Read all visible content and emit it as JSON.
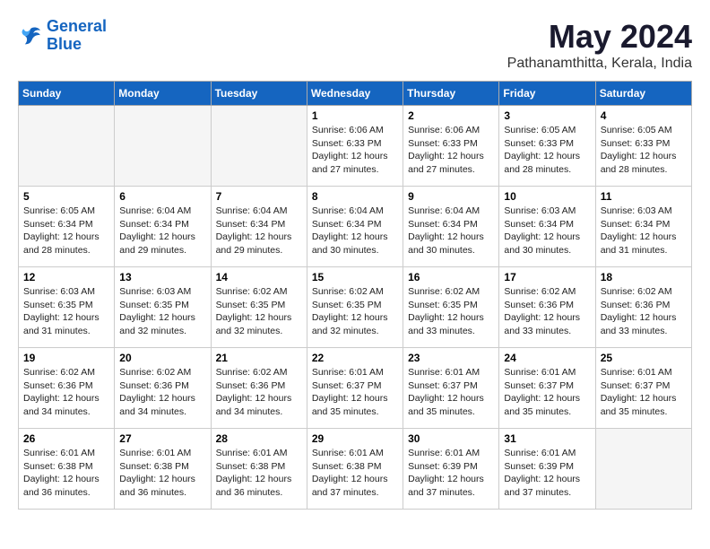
{
  "logo": {
    "line1": "General",
    "line2": "Blue"
  },
  "title": "May 2024",
  "location": "Pathanamthitta, Kerala, India",
  "weekdays": [
    "Sunday",
    "Monday",
    "Tuesday",
    "Wednesday",
    "Thursday",
    "Friday",
    "Saturday"
  ],
  "weeks": [
    [
      {
        "day": null,
        "sunrise": null,
        "sunset": null,
        "daylight": null
      },
      {
        "day": null,
        "sunrise": null,
        "sunset": null,
        "daylight": null
      },
      {
        "day": null,
        "sunrise": null,
        "sunset": null,
        "daylight": null
      },
      {
        "day": 1,
        "sunrise": "6:06 AM",
        "sunset": "6:33 PM",
        "daylight": "12 hours and 27 minutes."
      },
      {
        "day": 2,
        "sunrise": "6:06 AM",
        "sunset": "6:33 PM",
        "daylight": "12 hours and 27 minutes."
      },
      {
        "day": 3,
        "sunrise": "6:05 AM",
        "sunset": "6:33 PM",
        "daylight": "12 hours and 28 minutes."
      },
      {
        "day": 4,
        "sunrise": "6:05 AM",
        "sunset": "6:33 PM",
        "daylight": "12 hours and 28 minutes."
      }
    ],
    [
      {
        "day": 5,
        "sunrise": "6:05 AM",
        "sunset": "6:34 PM",
        "daylight": "12 hours and 28 minutes."
      },
      {
        "day": 6,
        "sunrise": "6:04 AM",
        "sunset": "6:34 PM",
        "daylight": "12 hours and 29 minutes."
      },
      {
        "day": 7,
        "sunrise": "6:04 AM",
        "sunset": "6:34 PM",
        "daylight": "12 hours and 29 minutes."
      },
      {
        "day": 8,
        "sunrise": "6:04 AM",
        "sunset": "6:34 PM",
        "daylight": "12 hours and 30 minutes."
      },
      {
        "day": 9,
        "sunrise": "6:04 AM",
        "sunset": "6:34 PM",
        "daylight": "12 hours and 30 minutes."
      },
      {
        "day": 10,
        "sunrise": "6:03 AM",
        "sunset": "6:34 PM",
        "daylight": "12 hours and 30 minutes."
      },
      {
        "day": 11,
        "sunrise": "6:03 AM",
        "sunset": "6:34 PM",
        "daylight": "12 hours and 31 minutes."
      }
    ],
    [
      {
        "day": 12,
        "sunrise": "6:03 AM",
        "sunset": "6:35 PM",
        "daylight": "12 hours and 31 minutes."
      },
      {
        "day": 13,
        "sunrise": "6:03 AM",
        "sunset": "6:35 PM",
        "daylight": "12 hours and 32 minutes."
      },
      {
        "day": 14,
        "sunrise": "6:02 AM",
        "sunset": "6:35 PM",
        "daylight": "12 hours and 32 minutes."
      },
      {
        "day": 15,
        "sunrise": "6:02 AM",
        "sunset": "6:35 PM",
        "daylight": "12 hours and 32 minutes."
      },
      {
        "day": 16,
        "sunrise": "6:02 AM",
        "sunset": "6:35 PM",
        "daylight": "12 hours and 33 minutes."
      },
      {
        "day": 17,
        "sunrise": "6:02 AM",
        "sunset": "6:36 PM",
        "daylight": "12 hours and 33 minutes."
      },
      {
        "day": 18,
        "sunrise": "6:02 AM",
        "sunset": "6:36 PM",
        "daylight": "12 hours and 33 minutes."
      }
    ],
    [
      {
        "day": 19,
        "sunrise": "6:02 AM",
        "sunset": "6:36 PM",
        "daylight": "12 hours and 34 minutes."
      },
      {
        "day": 20,
        "sunrise": "6:02 AM",
        "sunset": "6:36 PM",
        "daylight": "12 hours and 34 minutes."
      },
      {
        "day": 21,
        "sunrise": "6:02 AM",
        "sunset": "6:36 PM",
        "daylight": "12 hours and 34 minutes."
      },
      {
        "day": 22,
        "sunrise": "6:01 AM",
        "sunset": "6:37 PM",
        "daylight": "12 hours and 35 minutes."
      },
      {
        "day": 23,
        "sunrise": "6:01 AM",
        "sunset": "6:37 PM",
        "daylight": "12 hours and 35 minutes."
      },
      {
        "day": 24,
        "sunrise": "6:01 AM",
        "sunset": "6:37 PM",
        "daylight": "12 hours and 35 minutes."
      },
      {
        "day": 25,
        "sunrise": "6:01 AM",
        "sunset": "6:37 PM",
        "daylight": "12 hours and 35 minutes."
      }
    ],
    [
      {
        "day": 26,
        "sunrise": "6:01 AM",
        "sunset": "6:38 PM",
        "daylight": "12 hours and 36 minutes."
      },
      {
        "day": 27,
        "sunrise": "6:01 AM",
        "sunset": "6:38 PM",
        "daylight": "12 hours and 36 minutes."
      },
      {
        "day": 28,
        "sunrise": "6:01 AM",
        "sunset": "6:38 PM",
        "daylight": "12 hours and 36 minutes."
      },
      {
        "day": 29,
        "sunrise": "6:01 AM",
        "sunset": "6:38 PM",
        "daylight": "12 hours and 37 minutes."
      },
      {
        "day": 30,
        "sunrise": "6:01 AM",
        "sunset": "6:39 PM",
        "daylight": "12 hours and 37 minutes."
      },
      {
        "day": 31,
        "sunrise": "6:01 AM",
        "sunset": "6:39 PM",
        "daylight": "12 hours and 37 minutes."
      },
      {
        "day": null,
        "sunrise": null,
        "sunset": null,
        "daylight": null
      }
    ]
  ]
}
